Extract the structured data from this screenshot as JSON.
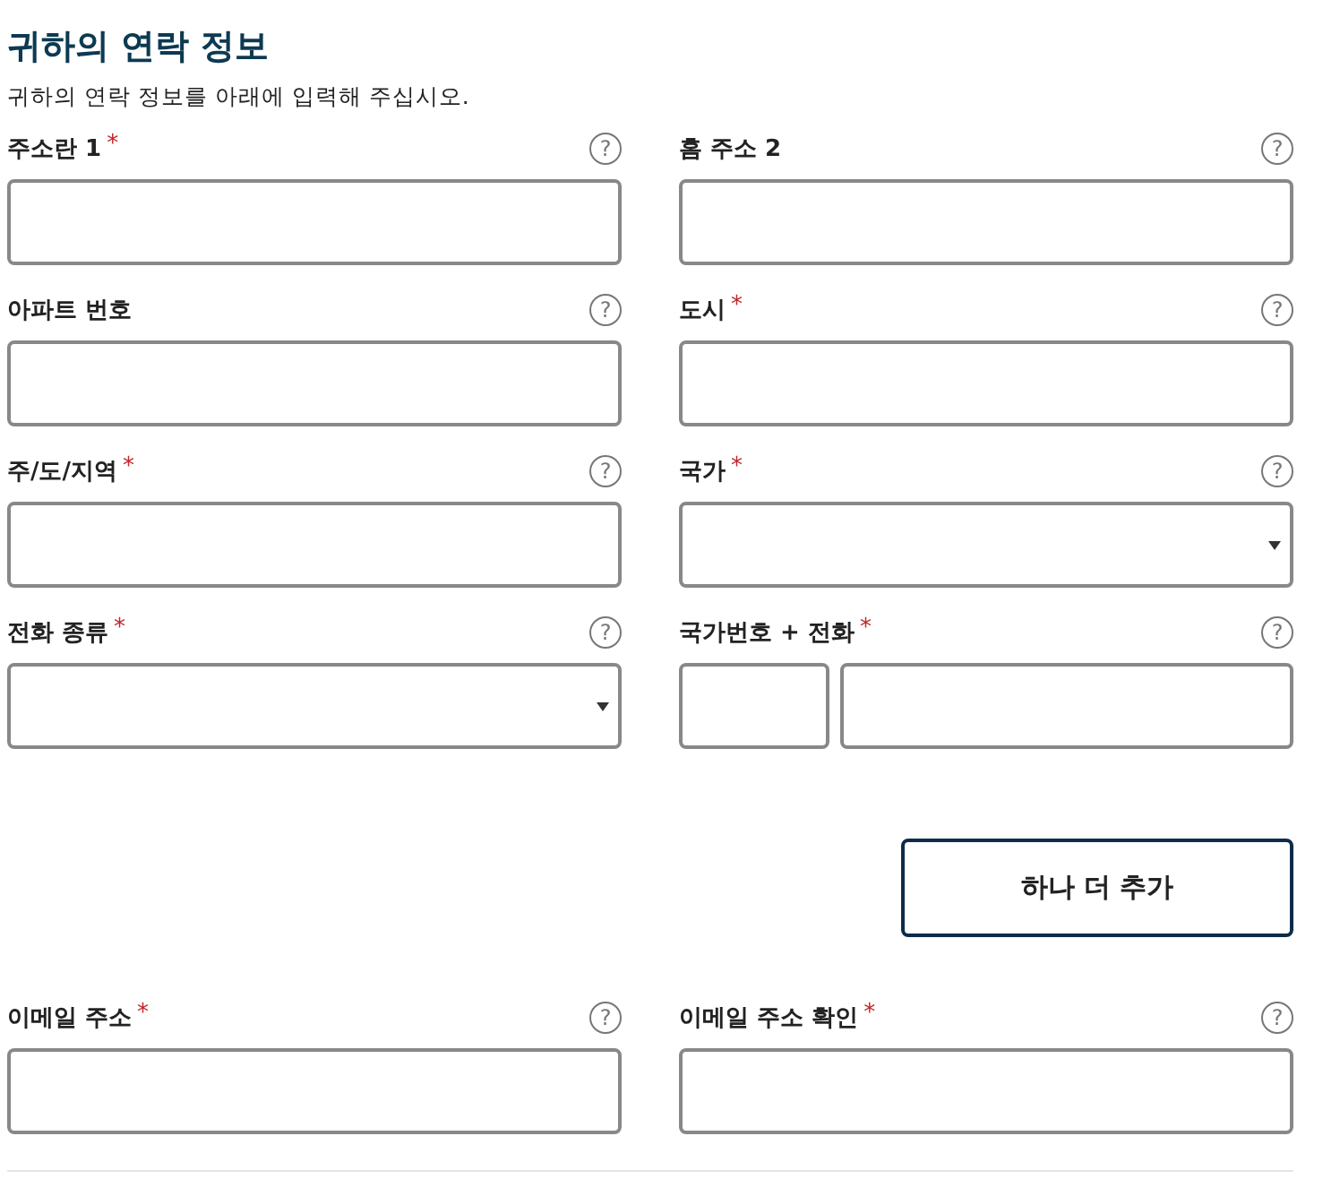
{
  "title": "귀하의 연락 정보",
  "subtitle": "귀하의 연락 정보를 아래에 입력해 주십시오.",
  "help_mark": "?",
  "required_mark": "*",
  "fields": [
    {
      "label": "주소란 1",
      "required": true,
      "kind": "text"
    },
    {
      "label": "홈 주소 2",
      "required": false,
      "kind": "text"
    },
    {
      "label": "아파트 번호",
      "required": false,
      "kind": "text"
    },
    {
      "label": "도시",
      "required": true,
      "kind": "text"
    },
    {
      "label": "주/도/지역",
      "required": true,
      "kind": "text"
    },
    {
      "label": "국가",
      "required": true,
      "kind": "select"
    },
    {
      "label": "전화 종류",
      "required": true,
      "kind": "select"
    },
    {
      "label": "국가번호 + 전화",
      "required": true,
      "kind": "phone"
    }
  ],
  "add_button": "하나 더 추가",
  "email_fields": [
    {
      "label": "이메일 주소",
      "required": true,
      "kind": "text"
    },
    {
      "label": "이메일 주소 확인",
      "required": true,
      "kind": "text"
    }
  ]
}
